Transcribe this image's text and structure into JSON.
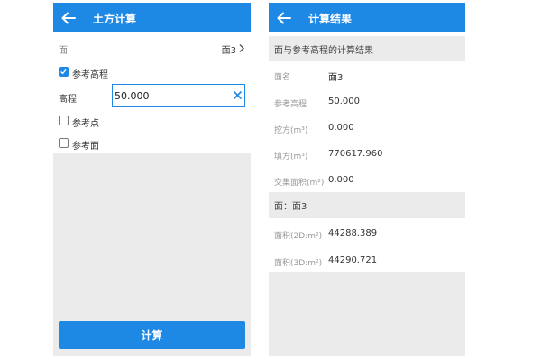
{
  "left": {
    "appbar": {
      "title": "土方计算"
    },
    "face": {
      "label": "面",
      "value": "面3"
    },
    "ref_elevation": {
      "label": "参考高程",
      "checked": true
    },
    "elevation": {
      "label": "高程",
      "value": "50.000"
    },
    "ref_point": {
      "label": "参考点",
      "checked": false
    },
    "ref_surface": {
      "label": "参考面",
      "checked": false
    },
    "calc_button": "计算"
  },
  "right": {
    "appbar": {
      "title": "计算结果"
    },
    "section1": {
      "title": "面与参考高程的计算结果"
    },
    "rows1": [
      {
        "label": "面名",
        "value": "面3"
      },
      {
        "label": "参考高程",
        "value": "50.000"
      },
      {
        "label": "挖方(m³)",
        "value": "0.000"
      },
      {
        "label": "填方(m³)",
        "value": "770617.960"
      },
      {
        "label": "交集面积(m²)",
        "value": "0.000"
      }
    ],
    "section2": {
      "title": "面：面3"
    },
    "rows2": [
      {
        "label": "面积(2D:m²)",
        "value": "44288.389"
      },
      {
        "label": "面积(3D:m²)",
        "value": "44290.721"
      }
    ]
  },
  "icons": [
    "back-arrow-icon",
    "chevron-right-icon",
    "clear-icon",
    "list-icon",
    "location-pin-icon",
    "checkbox-icon"
  ],
  "colors": {
    "accent": "#1e88e5",
    "panel_gray": "#ebebeb",
    "label_gray": "#999999"
  }
}
